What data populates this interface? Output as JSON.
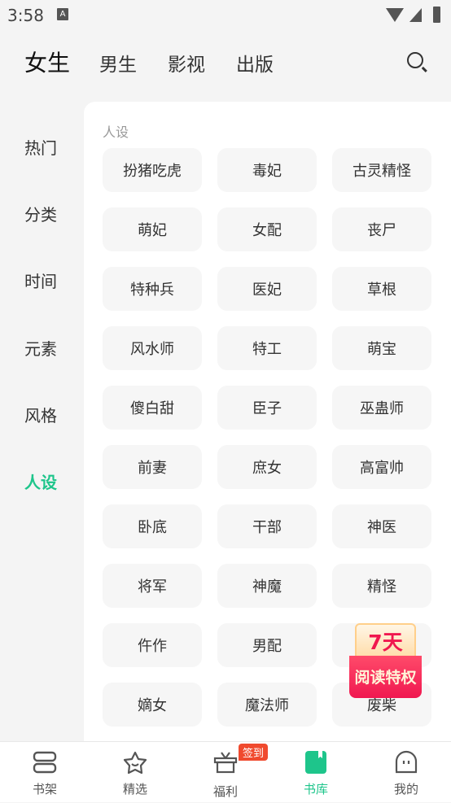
{
  "status": {
    "time": "3:58",
    "a_icon": "A"
  },
  "top_tabs": [
    "女生",
    "男生",
    "影视",
    "出版"
  ],
  "side": [
    "热门",
    "分类",
    "时间",
    "元素",
    "风格",
    "人设"
  ],
  "section_title": "人设",
  "tags": [
    "扮猪吃虎",
    "毒妃",
    "古灵精怪",
    "萌妃",
    "女配",
    "丧尸",
    "特种兵",
    "医妃",
    "草根",
    "风水师",
    "特工",
    "萌宝",
    "傻白甜",
    "臣子",
    "巫蛊师",
    "前妻",
    "庶女",
    "高富帅",
    "卧底",
    "干部",
    "神医",
    "将军",
    "神魔",
    "精怪",
    "仵作",
    "男配",
    "",
    "嫡女",
    "魔法师",
    "废柴"
  ],
  "promo": {
    "days": "7天",
    "text": "阅读特权"
  },
  "bottom_nav": [
    "书架",
    "精选",
    "福利",
    "书库",
    "我的"
  ],
  "badge": "签到",
  "colors": {
    "accent": "#1ec58b",
    "badge": "#f04a2e"
  }
}
